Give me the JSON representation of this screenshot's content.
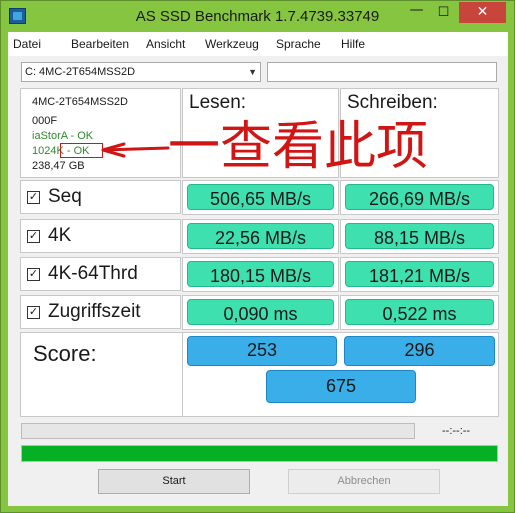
{
  "window": {
    "title": "AS SSD Benchmark 1.7.4739.33749",
    "controls": {
      "minimize": "—",
      "maximize": "☐",
      "close": "✕"
    }
  },
  "menu": [
    "Datei",
    "Bearbeiten",
    "Ansicht",
    "Werkzeug",
    "Sprache",
    "Hilfe"
  ],
  "drive": {
    "selected": "C: 4MC-2T654MSS2D",
    "extra_input_value": ""
  },
  "info": {
    "model": "4MC-2T654MSS2D",
    "firmware": "000F",
    "driver_status": "iaStorA - OK",
    "alignment_prefix": "1024",
    "alignment_status": "K - OK",
    "capacity": "238,47 GB"
  },
  "columns": {
    "read": "Lesen:",
    "write": "Schreiben:"
  },
  "tests": [
    {
      "label": "Seq",
      "checked": true,
      "read": "506,65 MB/s",
      "write": "266,69 MB/s"
    },
    {
      "label": "4K",
      "checked": true,
      "read": "22,56 MB/s",
      "write": "88,15 MB/s"
    },
    {
      "label": "4K-64Thrd",
      "checked": true,
      "read": "180,15 MB/s",
      "write": "181,21 MB/s"
    },
    {
      "label": "Zugriffszeit",
      "checked": true,
      "read": "0,090 ms",
      "write": "0,522 ms"
    }
  ],
  "score": {
    "label": "Score:",
    "read": "253",
    "write": "296",
    "total": "675"
  },
  "status": {
    "time": "--:--:--",
    "progress_top": 0,
    "progress_bottom": 1.0
  },
  "buttons": {
    "start": "Start",
    "cancel": "Abbrechen"
  },
  "annotation": {
    "text": "一查看此项",
    "color": "#d01515"
  }
}
